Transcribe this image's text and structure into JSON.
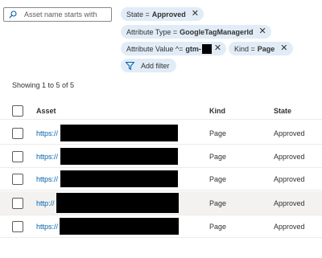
{
  "search": {
    "placeholder": "Asset name starts with",
    "value": ""
  },
  "filters": [
    {
      "label": "State =",
      "value": "Approved"
    },
    {
      "label": "Attribute Type =",
      "value": "GoogleTagManagerId"
    },
    {
      "label": "Attribute Value ^=",
      "value": "gtm-"
    },
    {
      "label": "Kind =",
      "value": "Page"
    }
  ],
  "filter_remove_glyph": "✕",
  "add_filter": {
    "label": "Add filter",
    "icon": "filter-icon"
  },
  "summary": "Showing 1 to 5 of 5",
  "table": {
    "columns": [
      "Asset",
      "Kind",
      "State"
    ],
    "rows": [
      {
        "asset": "https://",
        "kind": "Page",
        "state": "Approved"
      },
      {
        "asset": "https://",
        "kind": "Page",
        "state": "Approved"
      },
      {
        "asset": "https://",
        "kind": "Page",
        "state": "Approved"
      },
      {
        "asset": "http://",
        "kind": "Page",
        "state": "Approved"
      },
      {
        "asset": "https://",
        "kind": "Page",
        "state": "Approved"
      }
    ]
  },
  "colors": {
    "pill_bg": "#e1ecf7",
    "link": "#0062ad",
    "row_highlight": "#f3f2f1"
  }
}
